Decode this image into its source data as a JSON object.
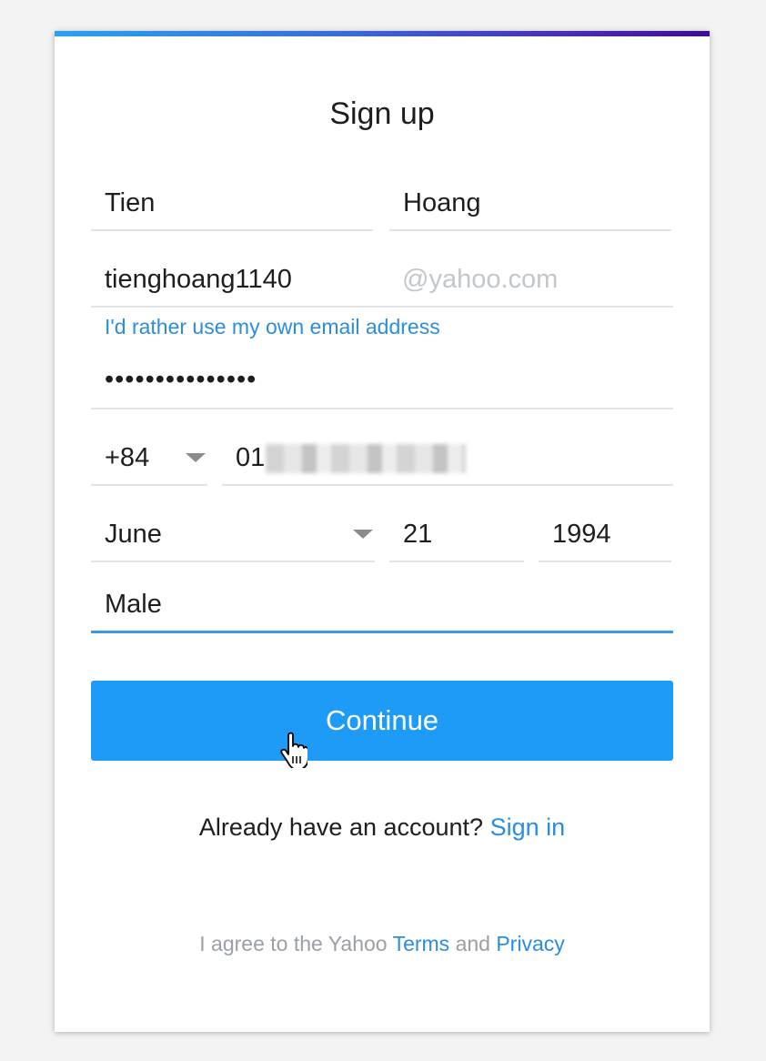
{
  "colors": {
    "accent": "#1e9bf6",
    "link": "#2a8de0",
    "top_bar_start": "#29a3ee",
    "top_bar_end": "#3d0f93"
  },
  "form": {
    "title": "Sign up",
    "first_name": "Tien",
    "last_name": "Hoang",
    "username": "tienghoang1140",
    "email_domain": "@yahoo.com",
    "own_email_link": "I'd rather use my own email address",
    "password_masked": "•••••••••••••••",
    "country_code": "+84",
    "phone_visible": "01",
    "birth_month": "June",
    "birth_day": "21",
    "birth_year": "1994",
    "gender": "Male",
    "continue_label": "Continue"
  },
  "footer": {
    "already_text": "Already have an account?",
    "sign_in_label": "Sign in",
    "terms_prefix": "I agree to the Yahoo",
    "terms_label": "Terms",
    "and_text": "and",
    "privacy_label": "Privacy"
  }
}
